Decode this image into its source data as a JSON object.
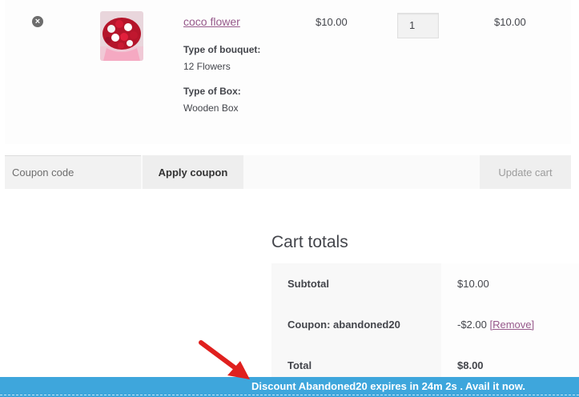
{
  "cart_item": {
    "remove_glyph": "×",
    "product_name": "coco flower",
    "meta": [
      {
        "key": "Type of bouquet:",
        "value": "12 Flowers"
      },
      {
        "key": "Type of Box:",
        "value": "Wooden Box"
      }
    ],
    "price": "$10.00",
    "quantity": "1",
    "subtotal": "$10.00"
  },
  "actions": {
    "coupon_placeholder": "Coupon code",
    "apply_label": "Apply coupon",
    "update_label": "Update cart"
  },
  "totals": {
    "title": "Cart totals",
    "rows": [
      {
        "label": "Subtotal",
        "value": "$10.00",
        "extra": ""
      },
      {
        "label": "Coupon: abandoned20",
        "value": "-$2.00 ",
        "extra": "[Remove]"
      },
      {
        "label": "Total",
        "value": "$8.00",
        "extra": ""
      }
    ]
  },
  "banner": {
    "text": "Discount Abandoned20 expires in 24m 2s . Avail it now."
  },
  "colors": {
    "link": "#96588a",
    "banner": "#3ea6dc",
    "arrow": "#e0201e"
  }
}
